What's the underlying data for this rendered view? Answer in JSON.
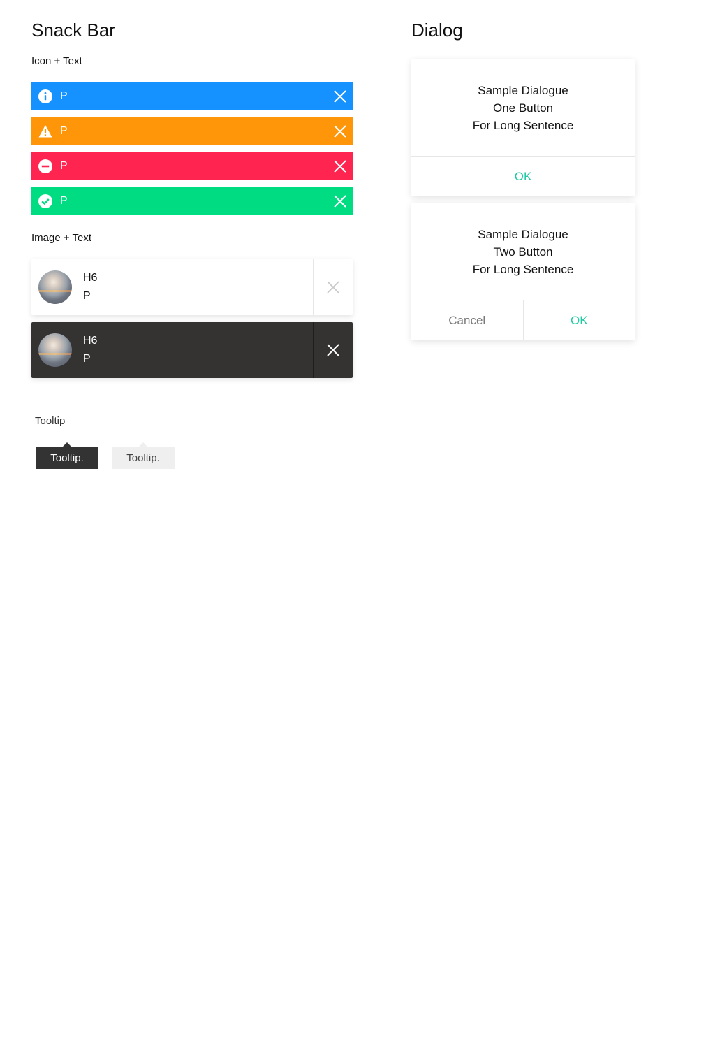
{
  "snackbar_section": {
    "title": "Snack Bar",
    "icon_text_label": "Icon + Text",
    "image_text_label": "Image + Text",
    "icon_bars": [
      {
        "type": "info",
        "text": "P",
        "color": "#1592ff",
        "icon": "info-icon"
      },
      {
        "type": "warning",
        "text": "P",
        "color": "#ff9509",
        "icon": "warning-icon"
      },
      {
        "type": "error",
        "text": "P",
        "color": "#ff2550",
        "icon": "minus-circle-icon"
      },
      {
        "type": "success",
        "text": "P",
        "color": "#00dc82",
        "icon": "check-circle-icon"
      }
    ],
    "image_bars": [
      {
        "theme": "light",
        "heading": "H6",
        "text": "P"
      },
      {
        "theme": "dark",
        "heading": "H6",
        "text": "P"
      }
    ]
  },
  "tooltip_section": {
    "label": "Tooltip",
    "tooltips": [
      {
        "theme": "dark",
        "text": "Tooltip."
      },
      {
        "theme": "light",
        "text": "Tooltip."
      }
    ]
  },
  "dialog_section": {
    "title": "Dialog",
    "dialogs": [
      {
        "lines": [
          "Sample Dialogue",
          "One Button",
          "For Long Sentence"
        ],
        "ok_label": "OK"
      },
      {
        "lines": [
          "Sample Dialogue",
          "Two Button",
          "For Long Sentence"
        ],
        "cancel_label": "Cancel",
        "ok_label": "OK"
      }
    ]
  },
  "colors": {
    "accent": "#1fc9a4",
    "dark_surface": "#353232"
  }
}
